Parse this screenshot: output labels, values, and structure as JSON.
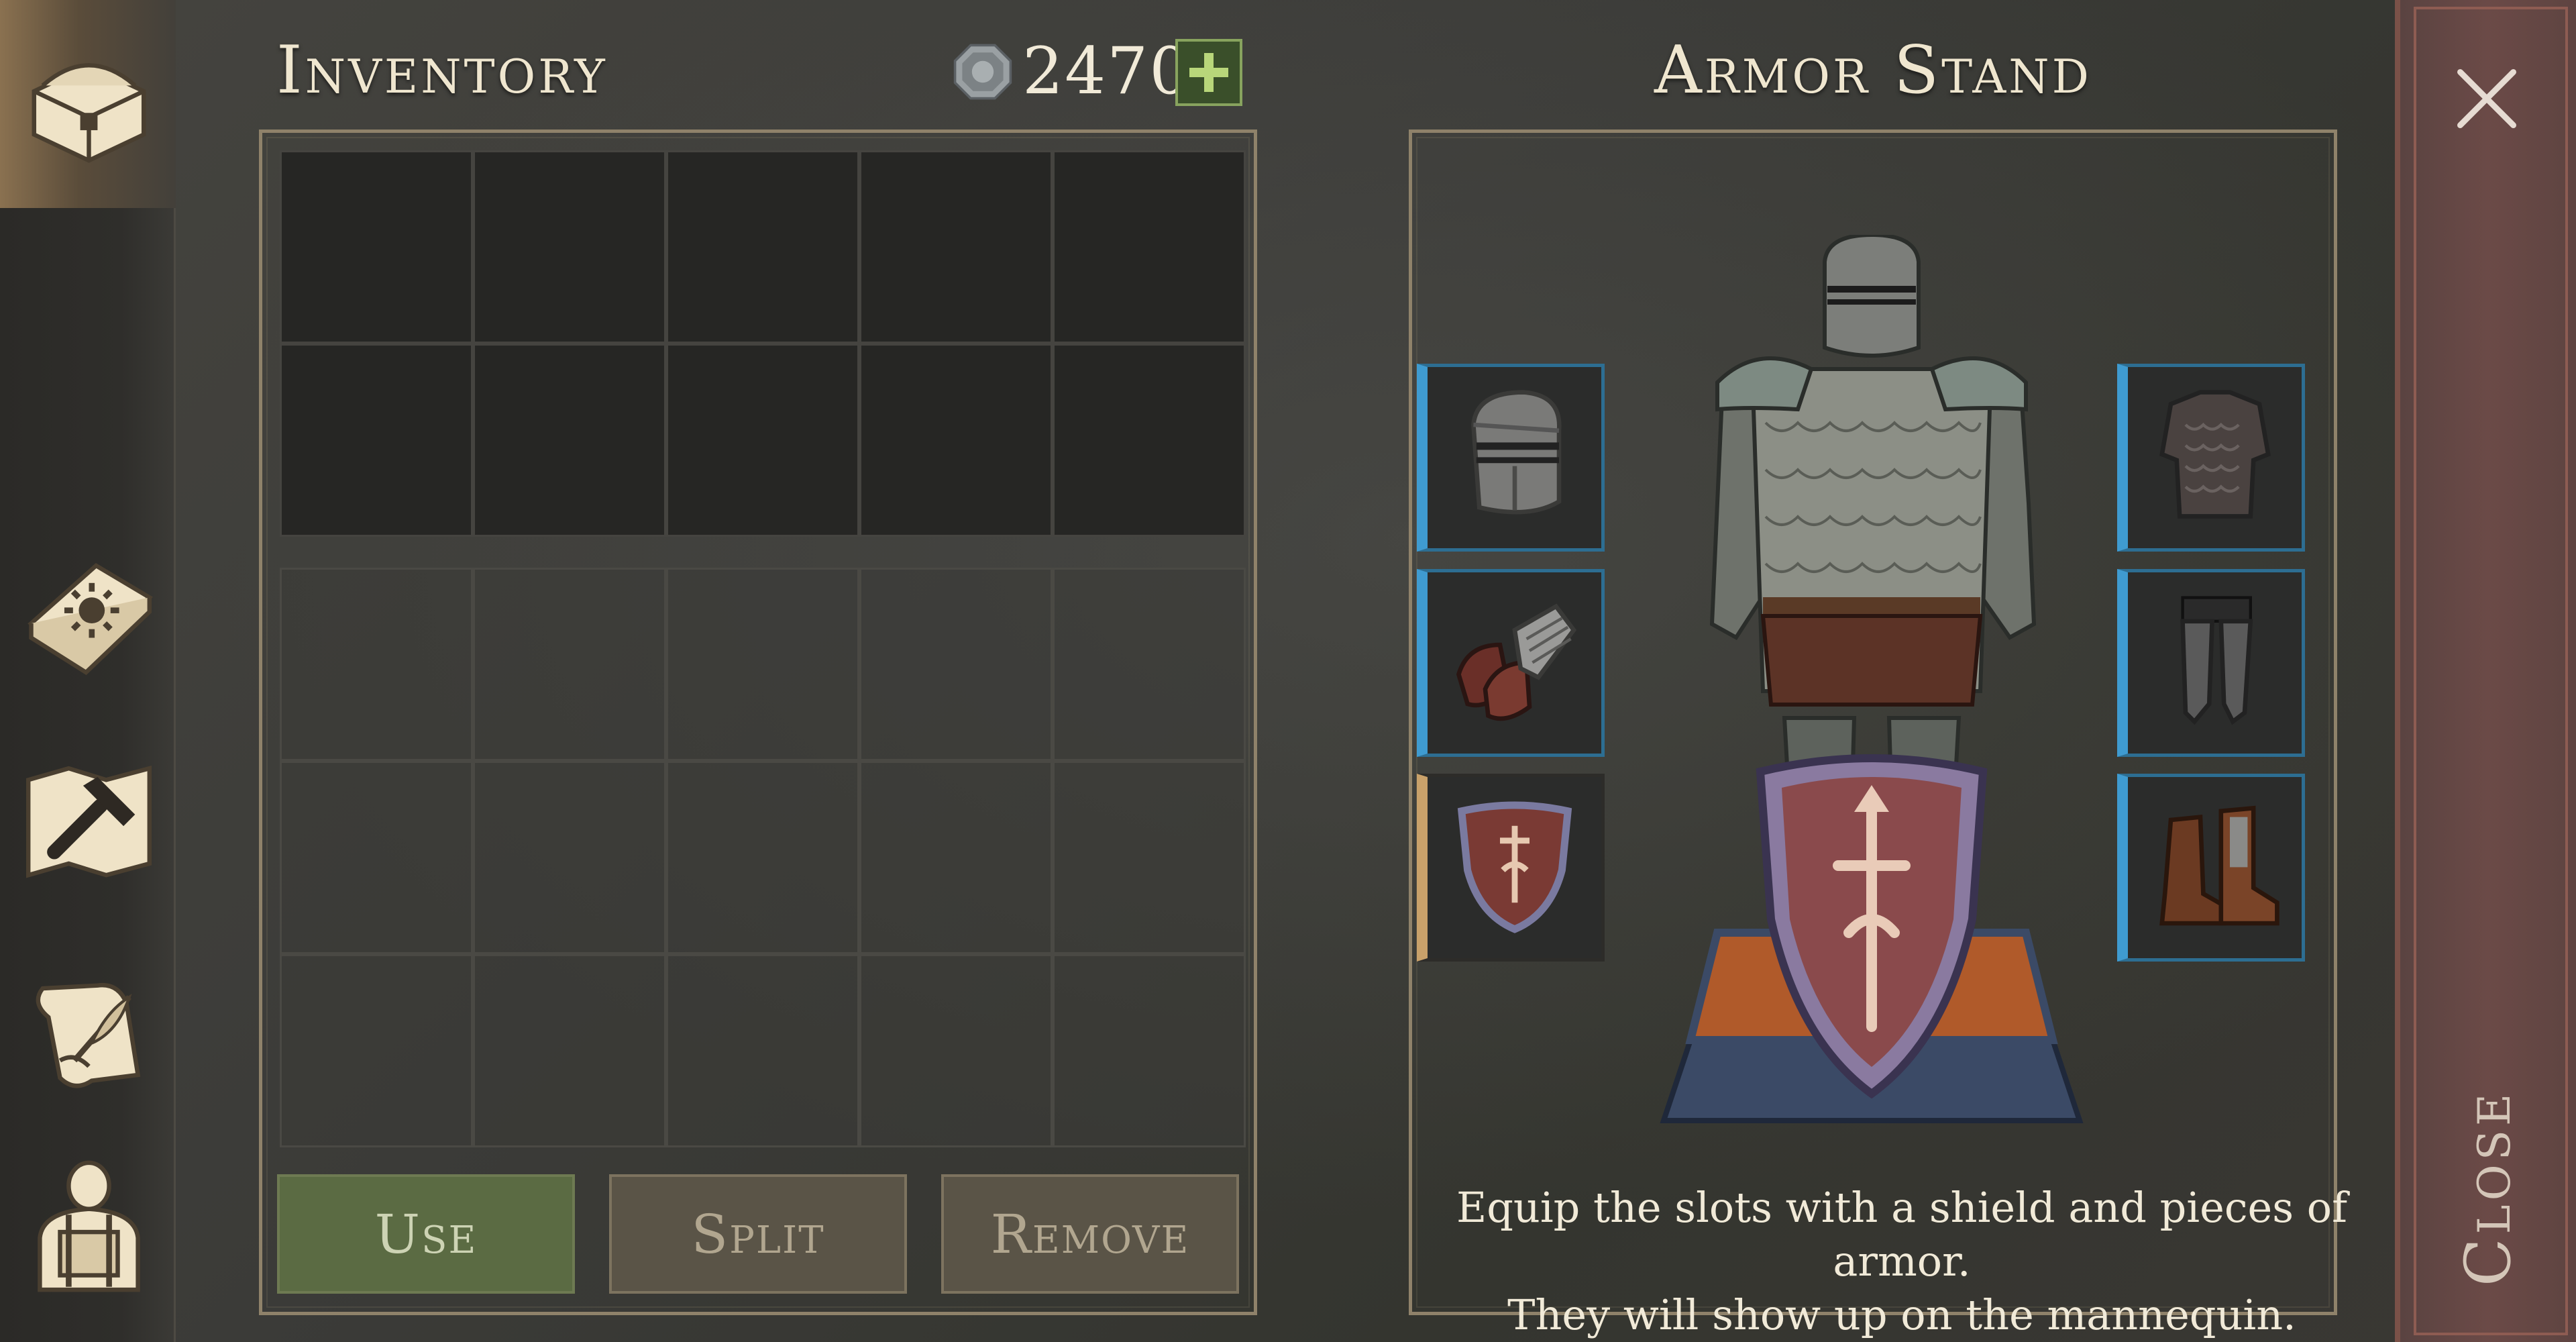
{
  "inventory": {
    "title": "Inventory",
    "currency_value": "2470",
    "currency_icon": "silver-coin-icon",
    "add_currency_icon": "plus-icon",
    "buttons": {
      "use": "Use",
      "split": "Split",
      "remove": "Remove"
    }
  },
  "armor_stand": {
    "title": "Armor Stand",
    "description_line1": "Equip the slots with a shield and pieces of armor.",
    "description_line2": "They will show up on the mannequin.",
    "slots_left": [
      "helmet-icon",
      "gauntlets-icon",
      "shield-icon"
    ],
    "slots_right": [
      "chest-armor-icon",
      "leg-armor-icon",
      "boots-icon"
    ]
  },
  "sidebar": {
    "items": [
      "chest-icon",
      "sun-book-icon",
      "map-hammer-icon",
      "scroll-quill-icon",
      "character-backpack-icon"
    ]
  },
  "close": {
    "label": "Close"
  },
  "colors": {
    "slot_accent": "#3f9bd0",
    "shield_accent": "#c9a16a",
    "use_button": "#5b6b43",
    "close_strip": "#6b4a47"
  }
}
